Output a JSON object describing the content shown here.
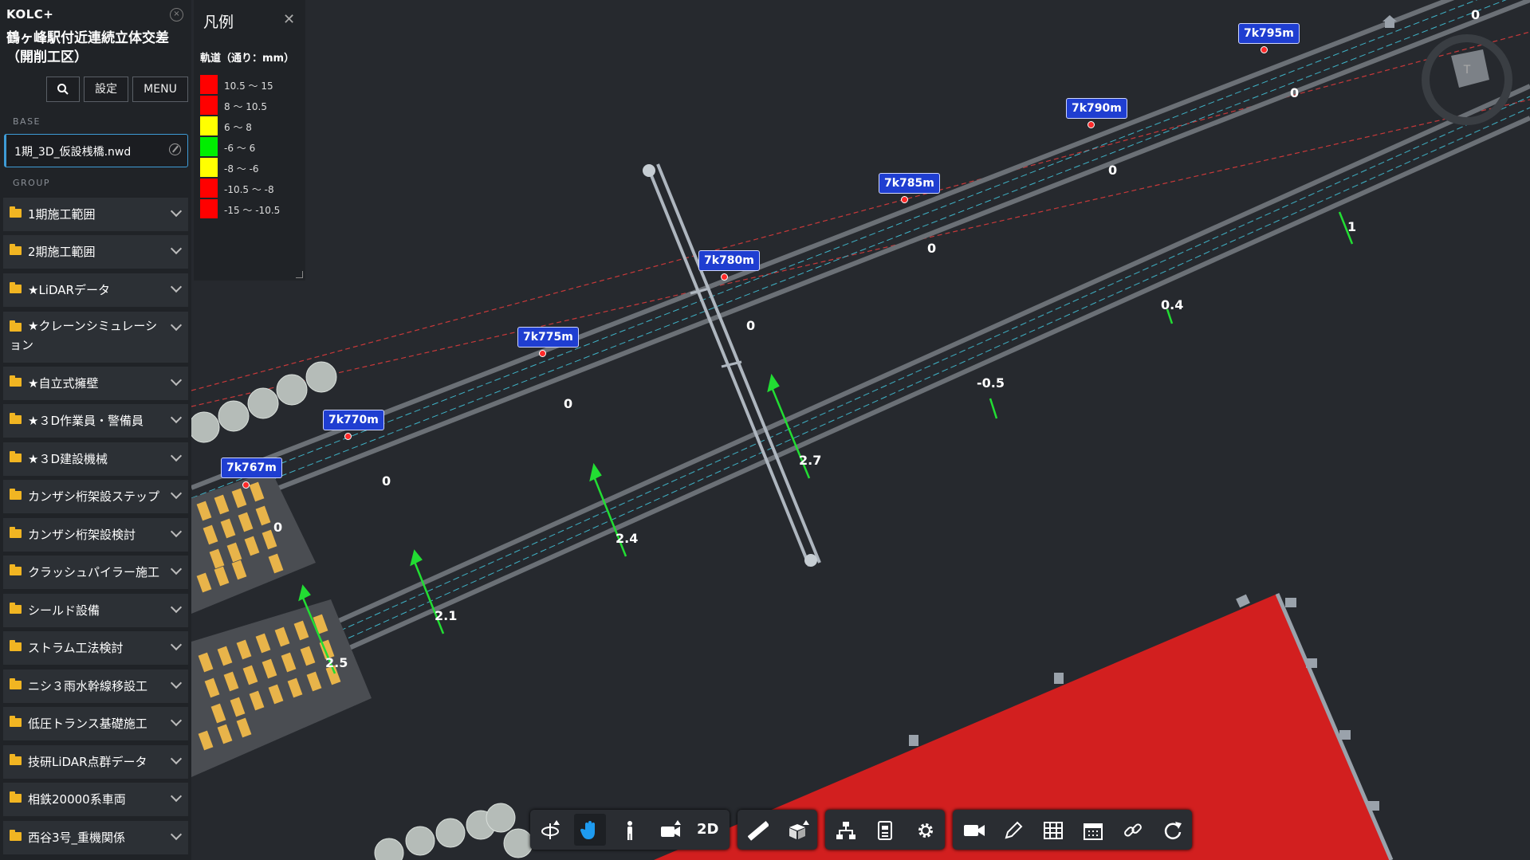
{
  "app": {
    "brand": "KOLC+",
    "project_title": "鶴ヶ峰駅付近連続立体交差（開削工区）"
  },
  "toolbar_top": {
    "settings_label": "設定",
    "menu_label": "MENU"
  },
  "base": {
    "section_label": "BASE",
    "file": "1期_3D_仮設桟橋.nwd"
  },
  "group": {
    "section_label": "GROUP",
    "items": [
      {
        "label": "1期施工範囲"
      },
      {
        "label": "2期施工範囲"
      },
      {
        "label": "★LiDARデータ"
      },
      {
        "label": "★クレーンシミュレーション"
      },
      {
        "label": "★自立式擁壁"
      },
      {
        "label": "★３D作業員・警備員"
      },
      {
        "label": "★３D建設機械"
      },
      {
        "label": "カンザシ桁架設ステップ"
      },
      {
        "label": "カンザシ桁架設検討"
      },
      {
        "label": "クラッシュパイラー施工"
      },
      {
        "label": "シールド設備"
      },
      {
        "label": "ストラム工法検討"
      },
      {
        "label": "ニシ３雨水幹線移設工"
      },
      {
        "label": "低圧トランス基礎施工"
      },
      {
        "label": "技研LiDAR点群データ"
      },
      {
        "label": "相鉄20000系車両"
      },
      {
        "label": "西谷3号_重機関係"
      }
    ]
  },
  "legend": {
    "title": "凡例",
    "subtitle": "軌道（通り：mm）",
    "rows": [
      {
        "label": "10.5 ～ 15",
        "color": "#ff0000"
      },
      {
        "label": "8 ～ 10.5",
        "color": "#ff0000"
      },
      {
        "label": "6 ～ 8",
        "color": "#ffff00"
      },
      {
        "label": "-6 ～ 6",
        "color": "#00ee00"
      },
      {
        "label": "-8 ～ -6",
        "color": "#ffff00"
      },
      {
        "label": "-10.5 ～ -8",
        "color": "#ff0000"
      },
      {
        "label": "-15 ～ -10.5",
        "color": "#ff0000"
      }
    ]
  },
  "stations": [
    "7k767m",
    "7k770m",
    "7k775m",
    "7k780m",
    "7k785m",
    "7k790m",
    "7k795m"
  ],
  "measurements": {
    "upper": [
      "0",
      "0",
      "0",
      "0",
      "0",
      "0",
      "0",
      "0"
    ],
    "lower": [
      "2.5",
      "2.1",
      "2.4",
      "2.7",
      "-0.5",
      "0.4",
      "1"
    ]
  },
  "bottom_toolbar": {
    "two_d_label": "2D",
    "icons": [
      "orbit-icon",
      "pan-icon",
      "walk-icon",
      "camera-icon",
      "measure-icon",
      "section-box-icon",
      "tree-icon",
      "properties-icon",
      "settings-icon",
      "video-icon",
      "markup-icon",
      "table-icon",
      "calendar-icon",
      "link-icon",
      "reset-icon"
    ]
  }
}
